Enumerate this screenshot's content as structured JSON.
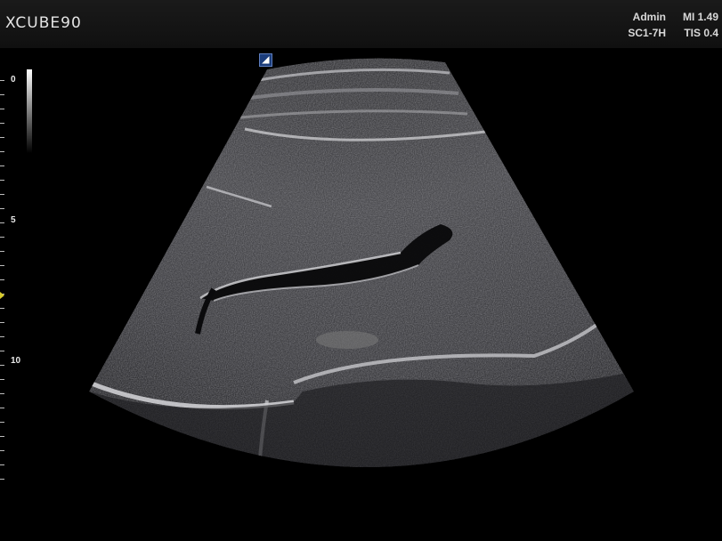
{
  "header": {
    "brand": "XCUBE90",
    "user": "Admin",
    "probe": "SC1-7H",
    "mi": "MI 1.49",
    "tis": "TIS 0.4"
  },
  "depth_scale": {
    "labels": [
      "0",
      "5",
      "10"
    ]
  },
  "orientation_marker": "◢",
  "colors": {
    "background": "#000000",
    "focus_marker": "#d6c92c",
    "orientation_marker": "#1b3c7a"
  },
  "image": {
    "type": "B-mode ultrasound sector image",
    "icon": "convex-sector-scan"
  }
}
